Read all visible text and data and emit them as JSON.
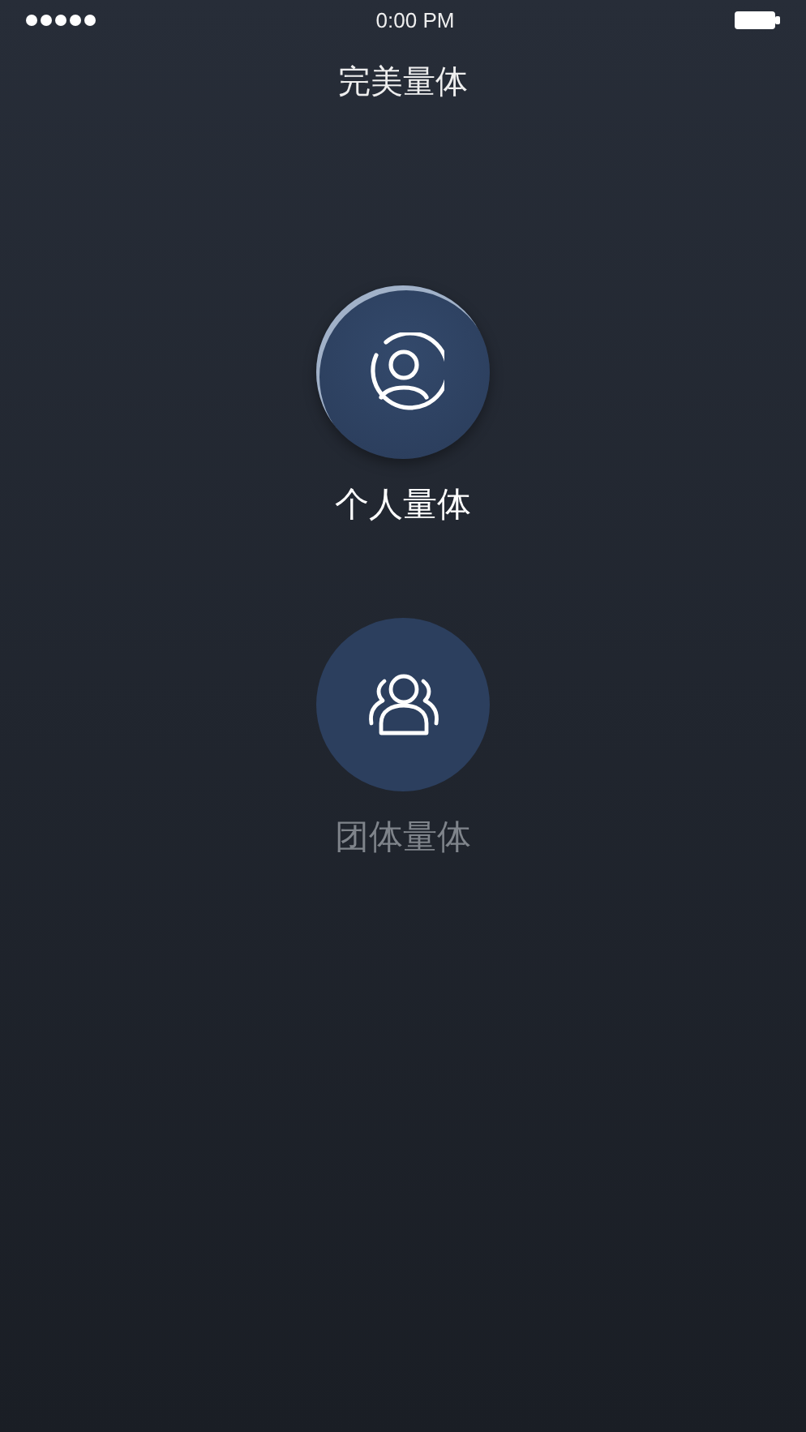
{
  "status_bar": {
    "time": "0:00 PM"
  },
  "title": "完美量体",
  "options": [
    {
      "kind": "person",
      "label": "个人量体",
      "selected": true
    },
    {
      "kind": "group",
      "label": "团体量体",
      "selected": false
    }
  ]
}
